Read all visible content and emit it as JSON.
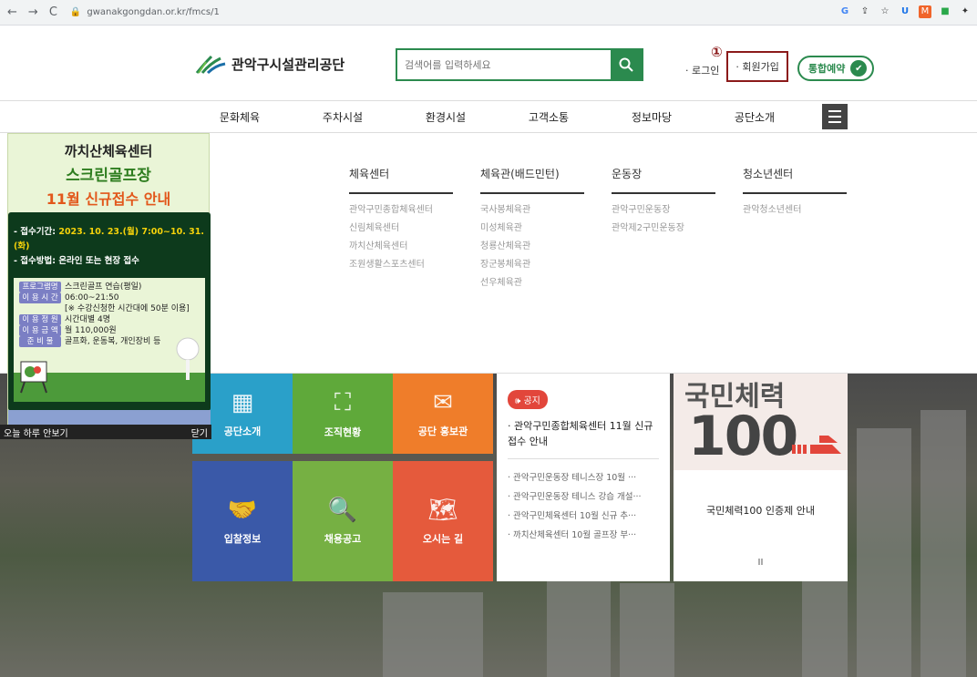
{
  "browser": {
    "nav": [
      "←",
      "→",
      "C"
    ],
    "lock": "🔒",
    "url": "gwanakgongdan.or.kr/fmcs/1",
    "ext": [
      "G",
      "⇪",
      "☆",
      "U",
      "M",
      "■",
      "✦"
    ]
  },
  "header": {
    "logo_text": "관악구시설관리공단",
    "search_placeholder": "검색어를 입력하세요",
    "search_icon": "🔍",
    "login": "· 로그인",
    "join": "· 회원가입",
    "booking": "통합예약",
    "booking_icon": "✔",
    "marker": "①"
  },
  "gnb": [
    "문화체육",
    "주차시설",
    "환경시설",
    "고객소통",
    "정보마당",
    "공단소개"
  ],
  "mega": [
    {
      "head": "체육센터",
      "items": [
        "관악구민종합체육센터",
        "신림체육센터",
        "까치산체육센터",
        "조원생활스포츠센터"
      ]
    },
    {
      "head": "체육관(배드민턴)",
      "items": [
        "국사봉체육관",
        "미성체육관",
        "청룡산체육관",
        "장군봉체육관",
        "선우체육관"
      ]
    },
    {
      "head": "운동장",
      "items": [
        "관악구민운동장",
        "관악제2구민운동장"
      ]
    },
    {
      "head": "청소년센터",
      "items": [
        "관악청소년센터"
      ]
    }
  ],
  "tiles": [
    {
      "label": "공단소개",
      "icon": "▦",
      "color": "#2aa0c9"
    },
    {
      "label": "조직현황",
      "icon": "⛶",
      "color": "#5fa93a"
    },
    {
      "label": "공단 홍보관",
      "icon": "✉",
      "color": "#ef7d2a"
    },
    {
      "label": "입찰정보",
      "icon": "🤝",
      "color": "#3a59a8"
    },
    {
      "label": "채용공고",
      "icon": "🔍",
      "color": "#76b043"
    },
    {
      "label": "오시는 길",
      "icon": "🗺",
      "color": "#e55a3c"
    }
  ],
  "notice": {
    "badge": "🕪 공지",
    "main": "· 관악구민종합체육센터 11월 신규접수 안내",
    "items": [
      "· 관악구민운동장 테니스장 10월 ···",
      "· 관악구민운동장 테니스 강습 개설···",
      "· 관악구민체육센터 10월 신규 추···",
      "· 까치산체육센터 10월 골프장 부···"
    ]
  },
  "fitness": {
    "title_small": "국민체력",
    "title_big": "100",
    "caption": "국민체력100 인증제 안내",
    "pause": "II"
  },
  "popup": {
    "t1": "까치산체육센터",
    "t2": "스크린골프장",
    "t3": "11월 신규접수 안내",
    "period_label": "- 접수기간: ",
    "period_value": "2023. 10. 23.(월) 7:00~10. 31.(화)",
    "method": "- 접수방법: 온라인 또는 현장 접수",
    "rows": [
      {
        "label": "프로그램명",
        "value": "스크린골프 연습(평일)"
      },
      {
        "label": "이 용 시 간",
        "value": "06:00~21:50"
      },
      {
        "label": "",
        "value": "[※ 수강신청한 시간대에 50분 이용]"
      },
      {
        "label": "이 용 정 원",
        "value": "시간대별 4명"
      },
      {
        "label": "이 용 금 액",
        "value": "월 110,000원"
      },
      {
        "label": "준 비 물",
        "value": "골프화, 운동복, 개인장비 등"
      }
    ],
    "hide_today": "오늘 하루 안보기",
    "close": "닫기"
  }
}
